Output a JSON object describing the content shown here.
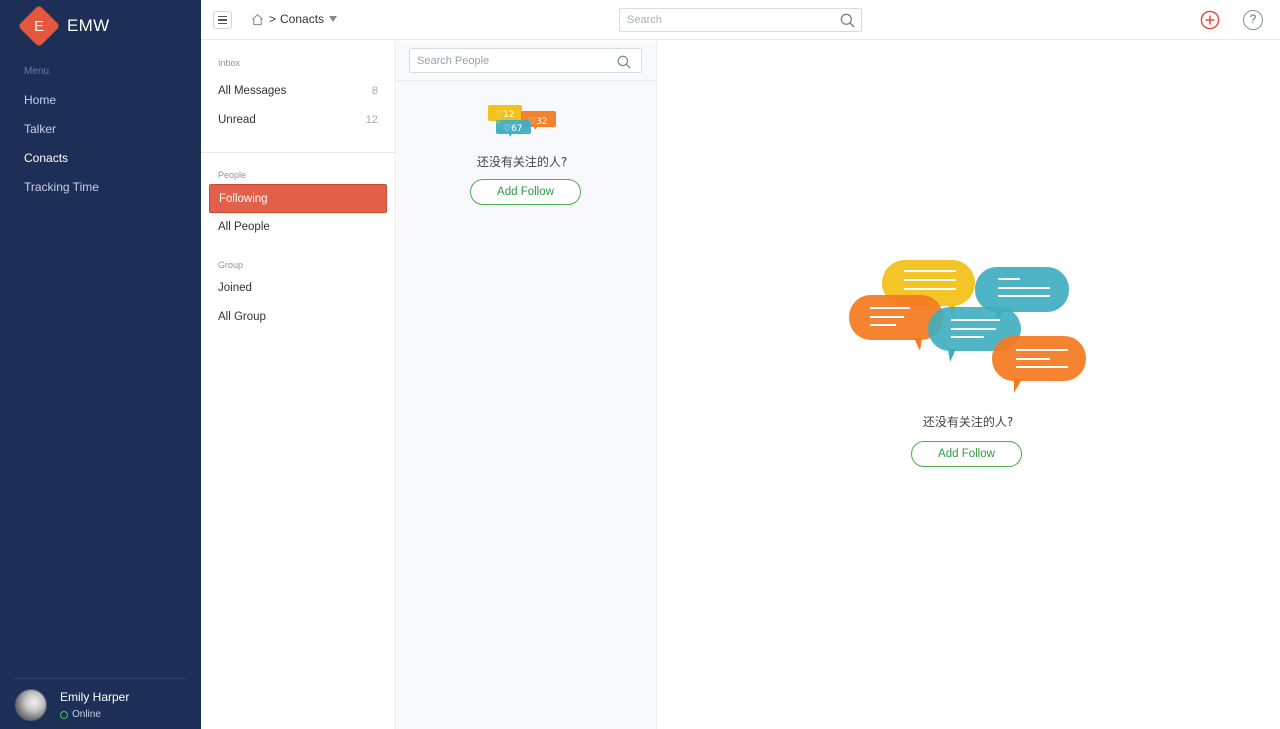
{
  "app": {
    "brand_letter": "E",
    "brand_name": "EMW"
  },
  "sidebar": {
    "menu_heading": "Menu",
    "items": [
      {
        "label": "Home",
        "active": false
      },
      {
        "label": "Talker",
        "active": false
      },
      {
        "label": "Conacts",
        "active": true
      },
      {
        "label": "Tracking Time",
        "active": false
      }
    ],
    "user": {
      "name": "Emily Harper",
      "status": "Online"
    }
  },
  "topbar": {
    "breadcrumb_sep": ">",
    "breadcrumb_current": "Conacts",
    "search_placeholder": "Search",
    "accent_color": "#e4573f"
  },
  "subnav": {
    "inbox": {
      "heading": "Inbox",
      "items": [
        {
          "label": "All Messages",
          "count": "8"
        },
        {
          "label": "Unread",
          "count": "12"
        }
      ]
    },
    "people": {
      "heading": "People",
      "items": [
        {
          "label": "Following",
          "active": true
        },
        {
          "label": "All People",
          "active": false
        }
      ]
    },
    "group": {
      "heading": "Group",
      "items": [
        {
          "label": "Joined"
        },
        {
          "label": "All Group"
        }
      ]
    }
  },
  "people_list": {
    "search_placeholder": "Search People",
    "badges": [
      "12",
      "32",
      "67"
    ],
    "empty_text": "还没有关注的人?",
    "button_label": "Add Follow"
  },
  "main": {
    "empty_text": "还没有关注的人?",
    "button_label": "Add Follow"
  },
  "colors": {
    "sidebar_bg": "#1d2f57",
    "active_item": "#e2604a",
    "follow_green": "#4caf50",
    "bubble_yellow": "#f2c21b",
    "bubble_blue": "#3fadc0",
    "bubble_orange": "#f57a1f"
  }
}
